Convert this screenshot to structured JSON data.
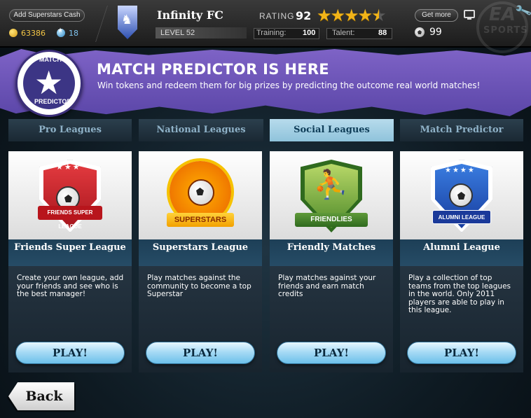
{
  "topbar": {
    "add_cash_label": "Add Superstars Cash",
    "coins": "63386",
    "tokens": "18",
    "club_name": "Infinity FC",
    "level": "LEVEL 52",
    "rating_label": "RATING",
    "rating_value": "92",
    "stars": 4.5,
    "training_label": "Training:",
    "training_value": "100",
    "talent_label": "Talent:",
    "talent_value": "88",
    "get_more_label": "Get more",
    "balls": "99",
    "brand": {
      "ea": "EA",
      "sports": "SPORTS"
    }
  },
  "banner": {
    "badge_top": "MATCH",
    "badge_bottom": "PREDICTOR",
    "title": "MATCH PREDICTOR IS HERE",
    "subtitle": "Win tokens and redeem them for big prizes by predicting the outcome real world matches!"
  },
  "tabs": [
    {
      "label": "Pro Leagues",
      "active": false
    },
    {
      "label": "National Leagues",
      "active": false
    },
    {
      "label": "Social Leagues",
      "active": true
    },
    {
      "label": "Match Predictor",
      "active": false
    }
  ],
  "cards": [
    {
      "crest_text": "FRIENDS SUPER LEAGUE",
      "title": "Friends Super League",
      "description": "Create your own league, add your friends and see who is the best manager!",
      "button": "PLAY!"
    },
    {
      "crest_text": "SUPERSTARS",
      "title": "Superstars League",
      "description": "Play matches against the community to become a top Superstar",
      "button": "PLAY!"
    },
    {
      "crest_text": "FRIENDLIES",
      "title": "Friendly Matches",
      "description": "Play matches against your friends and earn match credits",
      "button": "PLAY!"
    },
    {
      "crest_text": "ALUMNI LEAGUE",
      "title": "Alumni League",
      "description": "Play a collection of top teams from the top leagues in the world. Only 2011 players are able to play in this league.",
      "button": "PLAY!"
    }
  ],
  "back_label": "Back",
  "colors": {
    "banner": "#6b53b8",
    "tab_active": "#a6d2e8",
    "play_button": "#8fcff0",
    "star": "#f2b418"
  }
}
